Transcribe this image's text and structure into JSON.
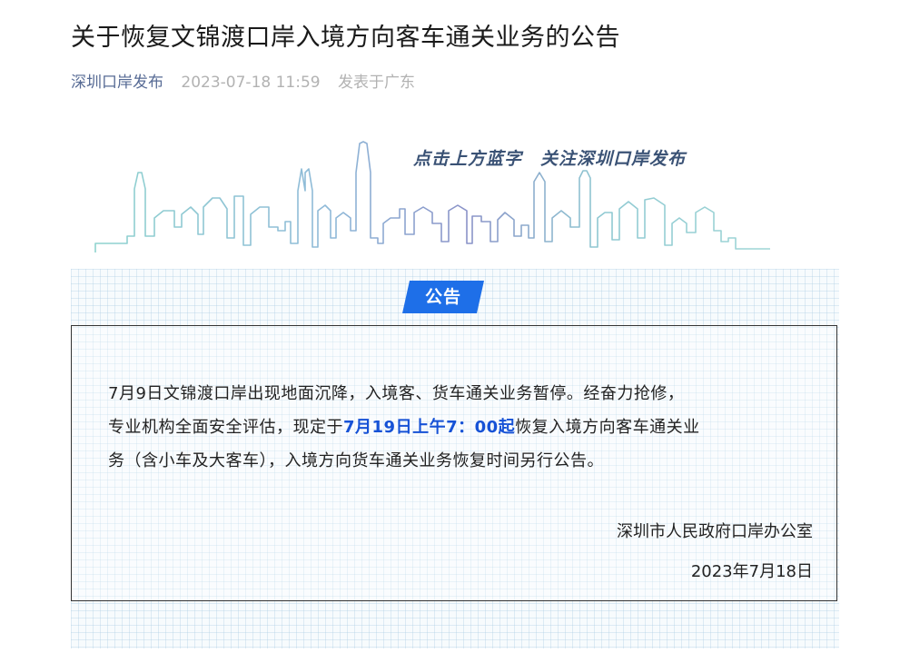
{
  "article": {
    "title": "关于恢复文锦渡口岸入境方向客车通关业务的公告",
    "account": "深圳口岸发布",
    "datetime": "2023-07-18 11:59",
    "location": "发表于广东"
  },
  "banner": {
    "slogan": "点击上方蓝字　关注深圳口岸发布"
  },
  "notice": {
    "tag": "公告",
    "line1": "7月9日文锦渡口岸出现地面沉降，入境客、货车通关业务暂停。经奋力抢修，",
    "line2_prefix": "专业机构全面安全评估，现定于",
    "line2_highlight": "7月19日上午7：00起",
    "line2_suffix": "恢复入境方向客车通关业",
    "line3": "务（含小车及大客车），入境方向货车通关业务恢复时间另行公告。",
    "signer": "深圳市人民政府口岸办公室",
    "date": "2023年7月18日"
  },
  "colors": {
    "account_link": "#576b95",
    "meta_gray": "#b2b2b2",
    "tag_blue": "#1e6fe8",
    "highlight_blue": "#1652d6",
    "slogan": "#3a5275"
  }
}
